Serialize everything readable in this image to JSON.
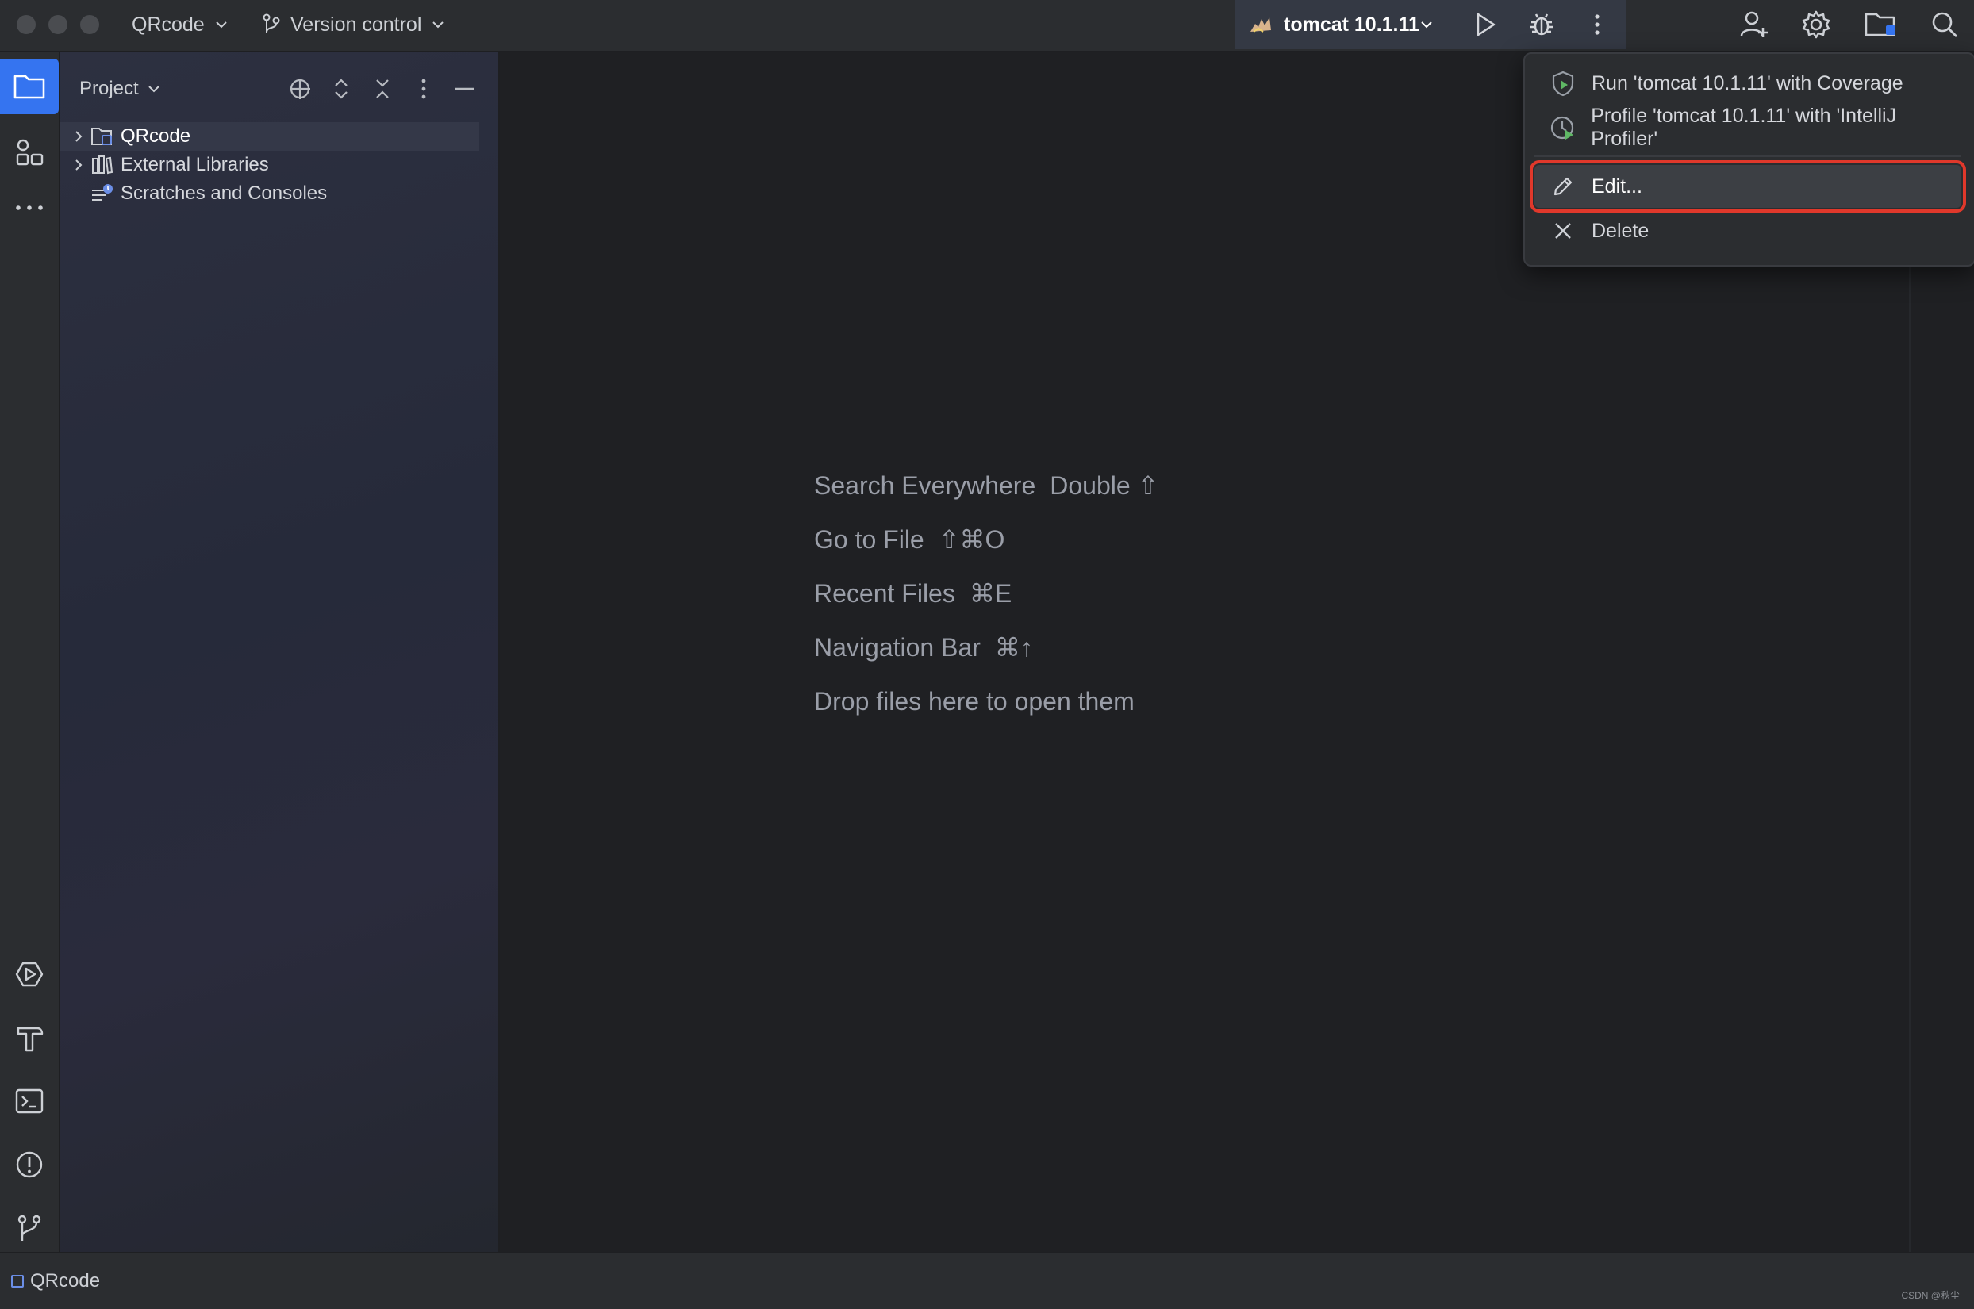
{
  "titlebar": {
    "project_label": "QRcode",
    "vcs_label": "Version control",
    "run_config": "tomcat 10.1.11"
  },
  "project_panel": {
    "title": "Project",
    "tree": [
      {
        "label": "QRcode",
        "expandable": true,
        "selected": true,
        "icon": "module-folder-icon"
      },
      {
        "label": "External Libraries",
        "expandable": true,
        "selected": false,
        "icon": "library-icon"
      },
      {
        "label": "Scratches and Consoles",
        "expandable": false,
        "selected": false,
        "icon": "scratches-icon"
      }
    ]
  },
  "editor": {
    "hints": [
      {
        "label": "Search Everywhere",
        "shortcut": "Double ⇧"
      },
      {
        "label": "Go to File",
        "shortcut": "⇧⌘O"
      },
      {
        "label": "Recent Files",
        "shortcut": "⌘E"
      },
      {
        "label": "Navigation Bar",
        "shortcut": "⌘↑"
      },
      {
        "label": "Drop files here to open them",
        "shortcut": ""
      }
    ]
  },
  "popup_menu": {
    "items": [
      {
        "label": "Run 'tomcat 10.1.11' with Coverage",
        "icon": "coverage-icon"
      },
      {
        "label": "Profile 'tomcat 10.1.11' with 'IntelliJ Profiler'",
        "icon": "profiler-icon"
      },
      {
        "label": "Edit...",
        "icon": "pencil-icon",
        "highlighted": true
      },
      {
        "label": "Delete",
        "icon": "close-icon"
      }
    ]
  },
  "statusbar": {
    "project": "QRcode",
    "watermark": "CSDN @秋尘"
  },
  "colors": {
    "accent": "#3574f0",
    "highlight_border": "#e0382b",
    "background": "#1f2023",
    "panel": "#2b2d30"
  }
}
